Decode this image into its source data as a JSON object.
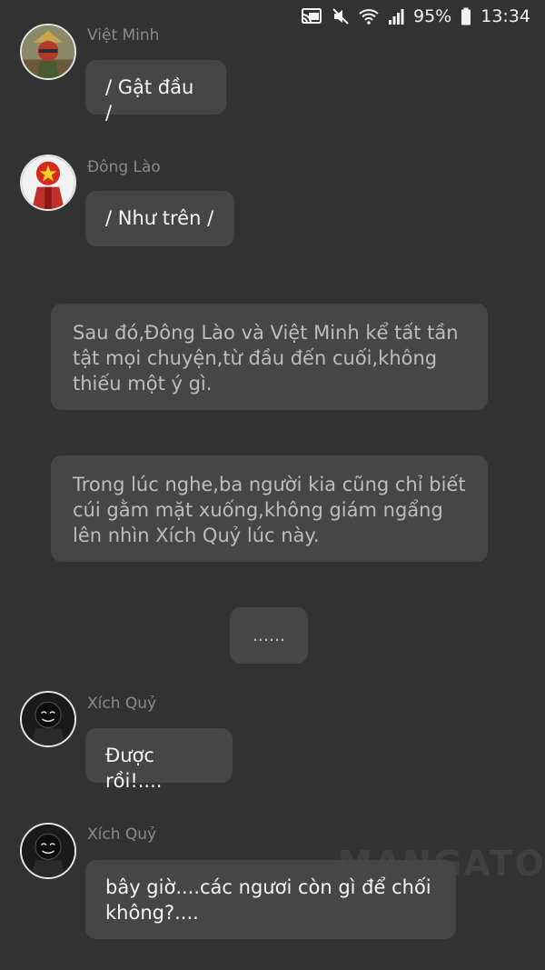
{
  "status_bar": {
    "battery": "95%",
    "time": "13:34",
    "icons": [
      "cast-icon",
      "mute-icon",
      "wifi-icon",
      "signal-icon",
      "battery-icon"
    ]
  },
  "messages": [
    {
      "sender": "Việt Minh",
      "text": "/ Gật đầu /",
      "avatar_icon": "viet-minh-avatar"
    },
    {
      "sender": "Đông Lào",
      "text": "/ Như trên /",
      "avatar_icon": "dong-lao-avatar"
    },
    {
      "sender": "Xích Quỷ",
      "text": "Được rồi!....",
      "avatar_icon": "xich-quy-avatar"
    },
    {
      "sender": "Xích Quỷ",
      "text": "bây giờ....các ngươi còn gì để chối không?....",
      "avatar_icon": "xich-quy-avatar"
    }
  ],
  "narrations": [
    "Sau đó,Đông Lào và Việt Minh kể tất tần tật mọi chuyện,từ đầu đến cuối,không thiếu một ý gì.",
    "Trong lúc nghe,ba người kia cũng chỉ biết cúi gằm mặt xuống,không giám ngẩng lên nhìn Xích Quỷ lúc này."
  ],
  "ellipsis": "......",
  "watermark": "MANGATOON",
  "colors": {
    "background": "#323232",
    "bubble": "#464646",
    "message_text": "#f5f5f5",
    "narration_text": "#bdbdbd",
    "sender_name": "#8a8a8a"
  }
}
